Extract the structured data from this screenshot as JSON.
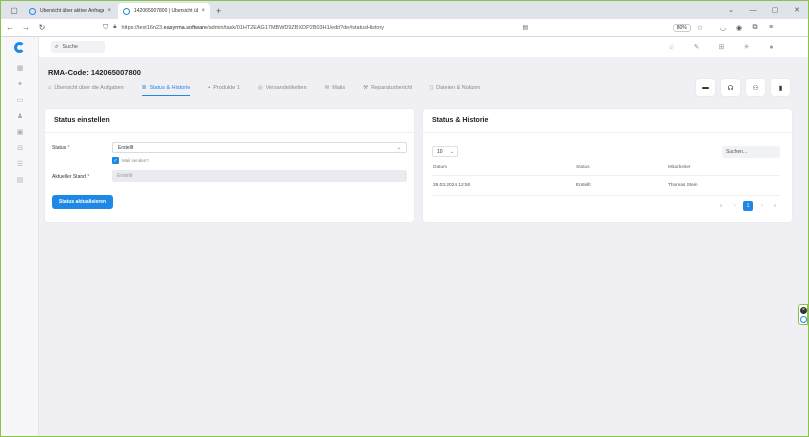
{
  "browser": {
    "tabs": [
      {
        "title": "Übersicht über aktive Anfragen",
        "active": false
      },
      {
        "title": "142065007800 | Übersicht über",
        "active": true
      }
    ],
    "url_prefix": "https://test16n23.",
    "url_host": "easyrma.software",
    "url_path": "/admin/task/01HT2EAG17MBWD9ZBXDP2B03H1/edit?de#statusHistory",
    "zoom": "80%"
  },
  "header": {
    "search_label": "Suche"
  },
  "page": {
    "title": "RMA-Code: 142065007800",
    "tabs": [
      {
        "label": "Übersicht über die Aufgaben",
        "icon": "home-icon"
      },
      {
        "label": "Status & Historie",
        "icon": "list-icon",
        "active": true
      },
      {
        "label": "Produkte 1",
        "icon": "box-icon"
      },
      {
        "label": "Versandetiketten",
        "icon": "label-icon"
      },
      {
        "label": "Mails",
        "icon": "mail-icon"
      },
      {
        "label": "Reparaturbericht",
        "icon": "wrench-icon"
      },
      {
        "label": "Dateien & Notizen",
        "icon": "file-icon"
      }
    ]
  },
  "status_card": {
    "title": "Status einstellen",
    "status_label": "Status",
    "status_value": "Erstellt",
    "mail_checkbox_label": "Mail senden?",
    "mail_checked": true,
    "current_label": "Aktueller Stand",
    "current_value": "Erstellt",
    "update_button": "Status aktualisieren",
    "required_mark": "*"
  },
  "history_card": {
    "title": "Status & Historie",
    "page_size": "10",
    "search_placeholder": "Suchen...",
    "columns": [
      "Datum",
      "Status",
      "Mitarbeiter"
    ],
    "rows": [
      {
        "date": "28.03.2024 12:50",
        "status": "Erstellt",
        "employee": "Thomas Stein"
      }
    ],
    "pagination": {
      "first": "«",
      "prev": "‹",
      "current": "1",
      "next": "›",
      "last": "»"
    }
  },
  "colors": {
    "accent": "#1e88e5",
    "required": "#e53935"
  }
}
